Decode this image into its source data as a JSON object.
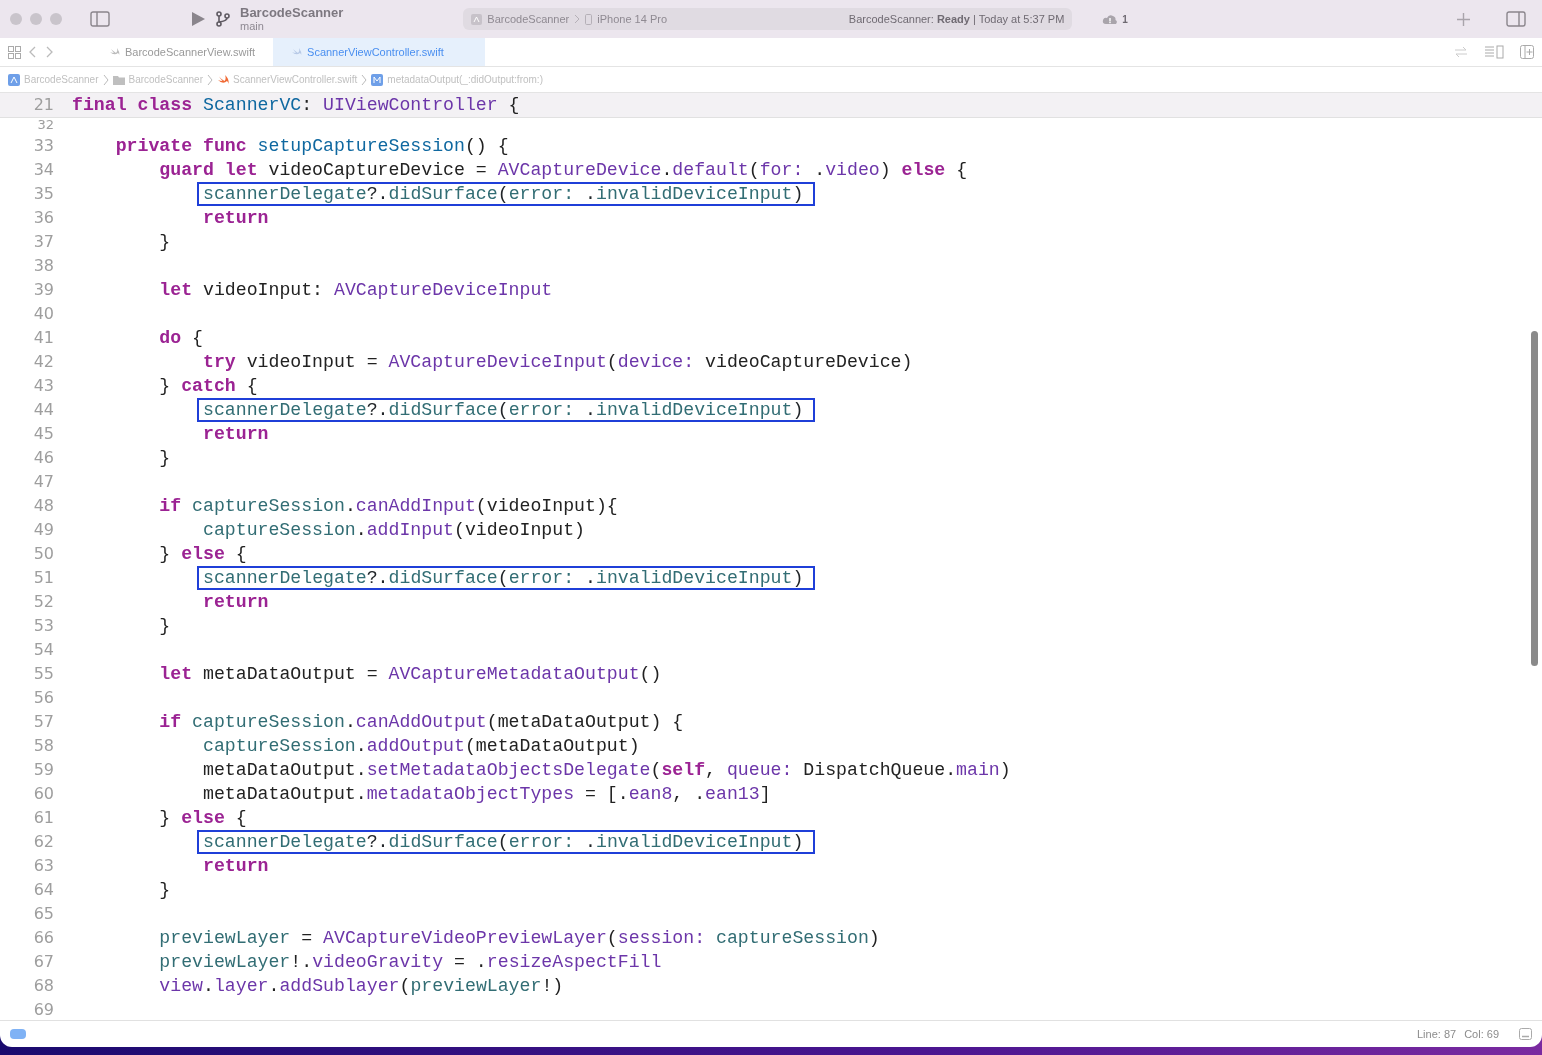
{
  "toolbar": {
    "project": "BarcodeScanner",
    "branch": "main",
    "scheme": "BarcodeScanner",
    "device": "iPhone 14 Pro",
    "status": "BarcodeScanner: **Ready** | Today at 5:37 PM",
    "warning_count": "1"
  },
  "tabs": [
    {
      "label": "BarcodeScannerView.swift",
      "selected": false
    },
    {
      "label": "ScannerViewController.swift",
      "selected": true
    }
  ],
  "breadcrumb": [
    {
      "kind": "app",
      "label": "BarcodeScanner"
    },
    {
      "kind": "folder",
      "label": "BarcodeScanner"
    },
    {
      "kind": "swift",
      "label": "ScannerViewController.swift"
    },
    {
      "kind": "method",
      "label": "metadataOutput(_:didOutput:from:)"
    }
  ],
  "sticky_line": {
    "number": "21",
    "tokens": [
      {
        "kind": "kw",
        "text": "final class"
      },
      {
        "kind": "decl",
        "text": " ScannerVC"
      },
      {
        "kind": "plain",
        "text": ":"
      },
      {
        "kind": "sys",
        "text": " UIViewController"
      },
      {
        "kind": "plain",
        "text": " {"
      }
    ]
  },
  "lines": [
    {
      "number": "32",
      "partial": true
    },
    {
      "number": "33",
      "tokens": [
        {
          "kind": "kw",
          "text": "    private func"
        },
        {
          "kind": "decl",
          "text": " setupCaptureSession"
        },
        {
          "kind": "plain",
          "text": "() {"
        }
      ]
    },
    {
      "number": "34",
      "tokens": [
        {
          "kind": "kw",
          "text": "        guard let"
        },
        {
          "kind": "plain",
          "text": " videoCaptureDevice ="
        },
        {
          "kind": "sys",
          "text": " AVCaptureDevice"
        },
        {
          "kind": "plain",
          "text": "."
        },
        {
          "kind": "sys",
          "text": "default"
        },
        {
          "kind": "plain",
          "text": "("
        },
        {
          "kind": "sys",
          "text": "for:"
        },
        {
          "kind": "plain",
          "text": " ."
        },
        {
          "kind": "sys",
          "text": "video"
        },
        {
          "kind": "plain",
          "text": ")"
        },
        {
          "kind": "kw",
          "text": " else"
        },
        {
          "kind": "plain",
          "text": " {"
        }
      ]
    },
    {
      "number": "35",
      "boxed": true,
      "tokens": [
        {
          "kind": "proj",
          "text": "            scannerDelegate"
        },
        {
          "kind": "plain",
          "text": "?."
        },
        {
          "kind": "proj",
          "text": "didSurface"
        },
        {
          "kind": "plain",
          "text": "("
        },
        {
          "kind": "proj",
          "text": "error:"
        },
        {
          "kind": "plain",
          "text": " ."
        },
        {
          "kind": "proj",
          "text": "invalidDeviceInput"
        },
        {
          "kind": "plain",
          "text": ")"
        }
      ]
    },
    {
      "number": "36",
      "tokens": [
        {
          "kind": "kw",
          "text": "            return"
        }
      ]
    },
    {
      "number": "37",
      "tokens": [
        {
          "kind": "plain",
          "text": "        }"
        }
      ]
    },
    {
      "number": "38"
    },
    {
      "number": "39",
      "tokens": [
        {
          "kind": "kw",
          "text": "        let"
        },
        {
          "kind": "plain",
          "text": " videoInput:"
        },
        {
          "kind": "sys",
          "text": " AVCaptureDeviceInput"
        }
      ]
    },
    {
      "number": "40"
    },
    {
      "number": "41",
      "tokens": [
        {
          "kind": "kw",
          "text": "        do"
        },
        {
          "kind": "plain",
          "text": " {"
        }
      ]
    },
    {
      "number": "42",
      "tokens": [
        {
          "kind": "kw",
          "text": "            try"
        },
        {
          "kind": "plain",
          "text": " videoInput ="
        },
        {
          "kind": "sys",
          "text": " AVCaptureDeviceInput"
        },
        {
          "kind": "plain",
          "text": "("
        },
        {
          "kind": "sys",
          "text": "device:"
        },
        {
          "kind": "plain",
          "text": " videoCaptureDevice)"
        }
      ]
    },
    {
      "number": "43",
      "tokens": [
        {
          "kind": "plain",
          "text": "        }"
        },
        {
          "kind": "kw",
          "text": " catch"
        },
        {
          "kind": "plain",
          "text": " {"
        }
      ]
    },
    {
      "number": "44",
      "boxed": true,
      "tokens": [
        {
          "kind": "proj",
          "text": "            scannerDelegate"
        },
        {
          "kind": "plain",
          "text": "?."
        },
        {
          "kind": "proj",
          "text": "didSurface"
        },
        {
          "kind": "plain",
          "text": "("
        },
        {
          "kind": "proj",
          "text": "error:"
        },
        {
          "kind": "plain",
          "text": " ."
        },
        {
          "kind": "proj",
          "text": "invalidDeviceInput"
        },
        {
          "kind": "plain",
          "text": ")"
        }
      ]
    },
    {
      "number": "45",
      "tokens": [
        {
          "kind": "kw",
          "text": "            return"
        }
      ]
    },
    {
      "number": "46",
      "tokens": [
        {
          "kind": "plain",
          "text": "        }"
        }
      ]
    },
    {
      "number": "47"
    },
    {
      "number": "48",
      "tokens": [
        {
          "kind": "kw",
          "text": "        if"
        },
        {
          "kind": "proj",
          "text": " captureSession"
        },
        {
          "kind": "plain",
          "text": "."
        },
        {
          "kind": "sys",
          "text": "canAddInput"
        },
        {
          "kind": "plain",
          "text": "(videoInput){"
        }
      ]
    },
    {
      "number": "49",
      "tokens": [
        {
          "kind": "proj",
          "text": "            captureSession"
        },
        {
          "kind": "plain",
          "text": "."
        },
        {
          "kind": "sys",
          "text": "addInput"
        },
        {
          "kind": "plain",
          "text": "(videoInput)"
        }
      ]
    },
    {
      "number": "50",
      "tokens": [
        {
          "kind": "plain",
          "text": "        }"
        },
        {
          "kind": "kw",
          "text": " else"
        },
        {
          "kind": "plain",
          "text": " {"
        }
      ]
    },
    {
      "number": "51",
      "boxed": true,
      "tokens": [
        {
          "kind": "proj",
          "text": "            scannerDelegate"
        },
        {
          "kind": "plain",
          "text": "?."
        },
        {
          "kind": "proj",
          "text": "didSurface"
        },
        {
          "kind": "plain",
          "text": "("
        },
        {
          "kind": "proj",
          "text": "error:"
        },
        {
          "kind": "plain",
          "text": " ."
        },
        {
          "kind": "proj",
          "text": "invalidDeviceInput"
        },
        {
          "kind": "plain",
          "text": ")"
        }
      ]
    },
    {
      "number": "52",
      "tokens": [
        {
          "kind": "kw",
          "text": "            return"
        }
      ]
    },
    {
      "number": "53",
      "tokens": [
        {
          "kind": "plain",
          "text": "        }"
        }
      ]
    },
    {
      "number": "54"
    },
    {
      "number": "55",
      "tokens": [
        {
          "kind": "kw",
          "text": "        let"
        },
        {
          "kind": "plain",
          "text": " metaDataOutput ="
        },
        {
          "kind": "sys",
          "text": " AVCaptureMetadataOutput"
        },
        {
          "kind": "plain",
          "text": "()"
        }
      ]
    },
    {
      "number": "56"
    },
    {
      "number": "57",
      "tokens": [
        {
          "kind": "kw",
          "text": "        if"
        },
        {
          "kind": "proj",
          "text": " captureSession"
        },
        {
          "kind": "plain",
          "text": "."
        },
        {
          "kind": "sys",
          "text": "canAddOutput"
        },
        {
          "kind": "plain",
          "text": "(metaDataOutput) {"
        }
      ]
    },
    {
      "number": "58",
      "tokens": [
        {
          "kind": "proj",
          "text": "            captureSession"
        },
        {
          "kind": "plain",
          "text": "."
        },
        {
          "kind": "sys",
          "text": "addOutput"
        },
        {
          "kind": "plain",
          "text": "(metaDataOutput)"
        }
      ]
    },
    {
      "number": "59",
      "tokens": [
        {
          "kind": "plain",
          "text": "            metaDataOutput."
        },
        {
          "kind": "sys",
          "text": "setMetadataObjectsDelegate"
        },
        {
          "kind": "plain",
          "text": "("
        },
        {
          "kind": "kw",
          "text": "self"
        },
        {
          "kind": "plain",
          "text": ","
        },
        {
          "kind": "sys",
          "text": " queue:"
        },
        {
          "kind": "plain",
          "text": " DispatchQueue."
        },
        {
          "kind": "sys",
          "text": "main"
        },
        {
          "kind": "plain",
          "text": ")"
        }
      ]
    },
    {
      "number": "60",
      "tokens": [
        {
          "kind": "plain",
          "text": "            metaDataOutput."
        },
        {
          "kind": "sys",
          "text": "metadataObjectTypes"
        },
        {
          "kind": "plain",
          "text": " = [."
        },
        {
          "kind": "sys",
          "text": "ean8"
        },
        {
          "kind": "plain",
          "text": ", ."
        },
        {
          "kind": "sys",
          "text": "ean13"
        },
        {
          "kind": "plain",
          "text": "]"
        }
      ]
    },
    {
      "number": "61",
      "tokens": [
        {
          "kind": "plain",
          "text": "        }"
        },
        {
          "kind": "kw",
          "text": " else"
        },
        {
          "kind": "plain",
          "text": " {"
        }
      ]
    },
    {
      "number": "62",
      "boxed": true,
      "tokens": [
        {
          "kind": "proj",
          "text": "            scannerDelegate"
        },
        {
          "kind": "plain",
          "text": "?."
        },
        {
          "kind": "proj",
          "text": "didSurface"
        },
        {
          "kind": "plain",
          "text": "("
        },
        {
          "kind": "proj",
          "text": "error:"
        },
        {
          "kind": "plain",
          "text": " ."
        },
        {
          "kind": "proj",
          "text": "invalidDeviceInput"
        },
        {
          "kind": "plain",
          "text": ")"
        }
      ]
    },
    {
      "number": "63",
      "tokens": [
        {
          "kind": "kw",
          "text": "            return"
        }
      ]
    },
    {
      "number": "64",
      "tokens": [
        {
          "kind": "plain",
          "text": "        }"
        }
      ]
    },
    {
      "number": "65"
    },
    {
      "number": "66",
      "tokens": [
        {
          "kind": "proj",
          "text": "        previewLayer"
        },
        {
          "kind": "plain",
          "text": " ="
        },
        {
          "kind": "sys",
          "text": " AVCaptureVideoPreviewLayer"
        },
        {
          "kind": "plain",
          "text": "("
        },
        {
          "kind": "sys",
          "text": "session:"
        },
        {
          "kind": "proj",
          "text": " captureSession"
        },
        {
          "kind": "plain",
          "text": ")"
        }
      ]
    },
    {
      "number": "67",
      "tokens": [
        {
          "kind": "proj",
          "text": "        previewLayer"
        },
        {
          "kind": "plain",
          "text": "!."
        },
        {
          "kind": "sys",
          "text": "videoGravity"
        },
        {
          "kind": "plain",
          "text": " = ."
        },
        {
          "kind": "sys",
          "text": "resizeAspectFill"
        }
      ]
    },
    {
      "number": "68",
      "tokens": [
        {
          "kind": "sys",
          "text": "        view"
        },
        {
          "kind": "plain",
          "text": "."
        },
        {
          "kind": "sys",
          "text": "layer"
        },
        {
          "kind": "plain",
          "text": "."
        },
        {
          "kind": "sys",
          "text": "addSublayer"
        },
        {
          "kind": "plain",
          "text": "("
        },
        {
          "kind": "proj",
          "text": "previewLayer"
        },
        {
          "kind": "plain",
          "text": "!)"
        }
      ]
    },
    {
      "number": "69"
    }
  ],
  "status_bar": {
    "line": "Line: 87",
    "col": "Col: 69"
  }
}
